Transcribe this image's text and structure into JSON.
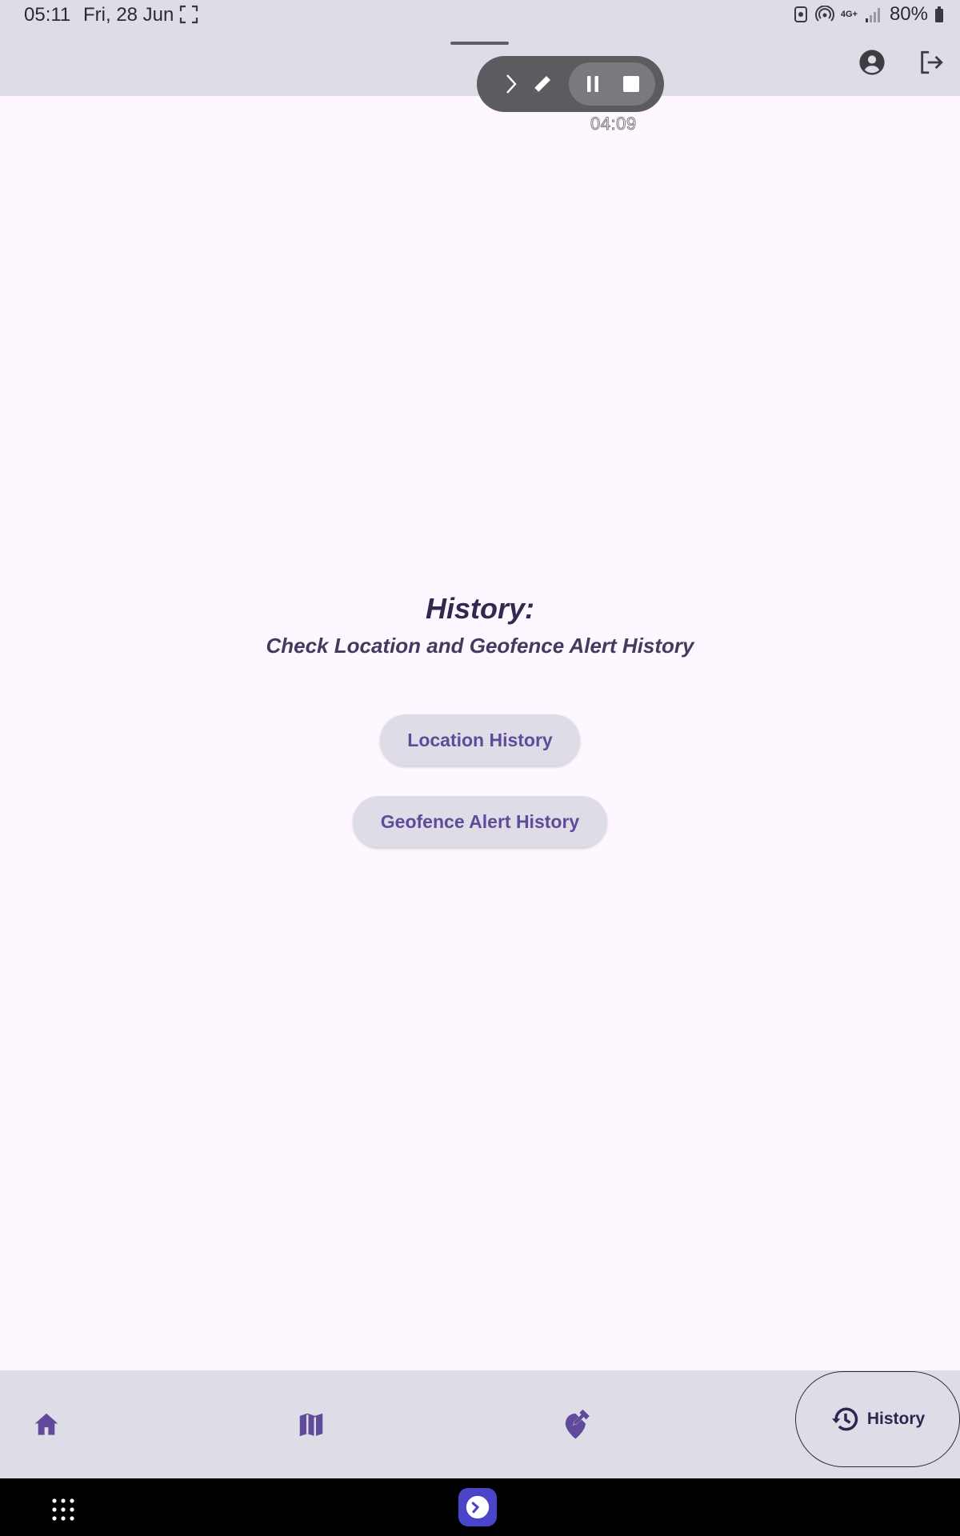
{
  "status_bar": {
    "time": "05:11",
    "date": "Fri, 28 Jun",
    "network": "4G+",
    "battery": "80%"
  },
  "recorder": {
    "timer": "04:09"
  },
  "main": {
    "title": "History:",
    "subtitle": "Check Location and Geofence Alert History",
    "buttons": [
      {
        "label": "Location History"
      },
      {
        "label": "Geofence Alert History"
      }
    ]
  },
  "bottom_nav": {
    "items": [
      {
        "icon": "home-icon"
      },
      {
        "icon": "map-icon"
      },
      {
        "icon": "geofence-edit-icon"
      },
      {
        "icon": "history-icon",
        "label": "History",
        "selected": true
      }
    ]
  },
  "colors": {
    "background": "#fef7ff",
    "bar": "#dedde7",
    "accent": "#5f4b9a",
    "title": "#31294f"
  }
}
